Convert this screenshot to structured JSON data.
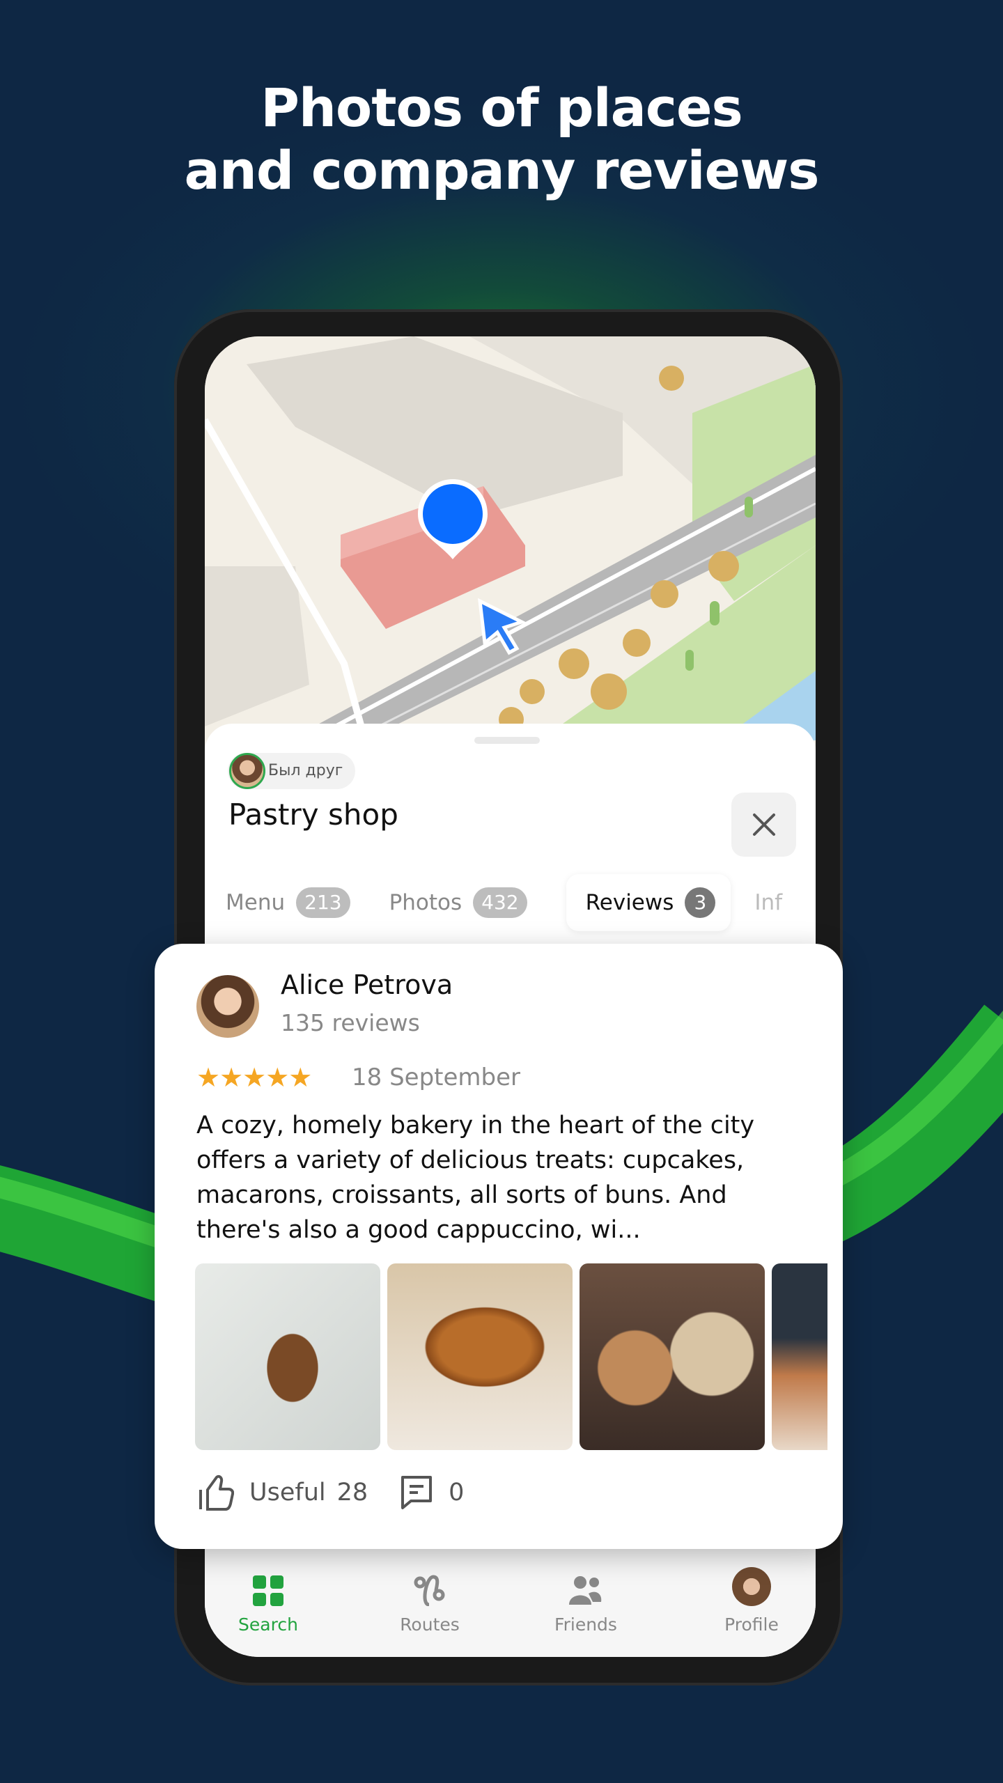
{
  "headline": {
    "line1": "Photos of places",
    "line2": "and company reviews"
  },
  "colors": {
    "accent": "#22a33f",
    "star": "#f5a623",
    "pin": "#0a6cff"
  },
  "sheet": {
    "friend_chip": "Был друг",
    "place_title": "Pastry shop",
    "tabs": [
      {
        "label": "Menu",
        "badge": "213"
      },
      {
        "label": "Photos",
        "badge": "432"
      },
      {
        "label": "Reviews",
        "badge": "3",
        "active": true
      },
      {
        "label": "Inf"
      }
    ]
  },
  "review": {
    "author": "Alice Petrova",
    "reviews_count": "135 reviews",
    "rating": 5,
    "stars": "★★★★★",
    "date": "18 September",
    "text": "A cozy, homely bakery in the heart of the city offers a variety of delicious treats: cupcakes, macarons, croissants, all sorts of buns. And there's also a good cappuccino, wi...",
    "photos": [
      "coffee",
      "croissant",
      "cupcakes",
      "pastries"
    ],
    "useful_label": "Useful",
    "useful_count": "28",
    "comments_count": "0"
  },
  "nav": {
    "items": [
      {
        "label": "Search",
        "icon": "grid-icon",
        "active": true
      },
      {
        "label": "Routes",
        "icon": "routes-icon"
      },
      {
        "label": "Friends",
        "icon": "friends-icon"
      },
      {
        "label": "Profile",
        "icon": "avatar"
      }
    ]
  }
}
